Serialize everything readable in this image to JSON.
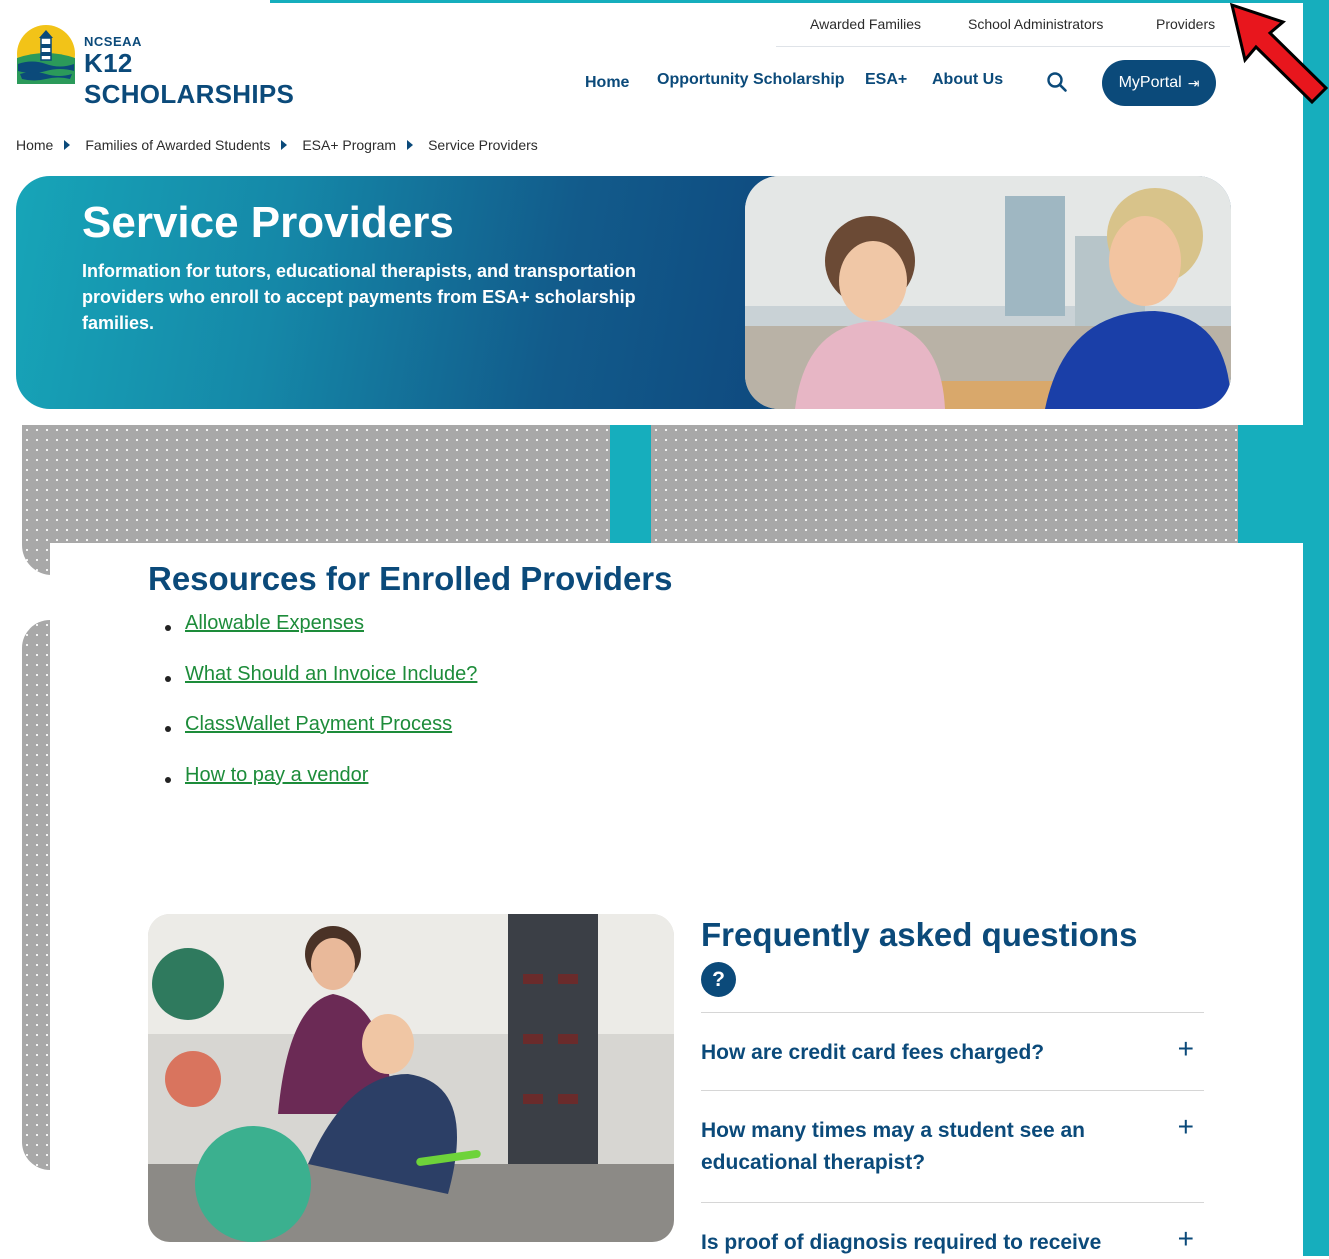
{
  "brand": {
    "small": "NCSEAA",
    "big": "K12 SCHOLARSHIPS"
  },
  "util_nav": [
    "Awarded Families",
    "School Administrators",
    "Providers"
  ],
  "main_nav": [
    "Home",
    "Opportunity Scholarship",
    "ESA+",
    "About Us"
  ],
  "myportal_label": "MyPortal",
  "breadcrumb": [
    "Home",
    "Families of Awarded Students",
    "ESA+ Program",
    "Service Providers"
  ],
  "hero": {
    "title": "Service Providers",
    "subtitle": "Information for tutors, educational therapists, and transportation providers who enroll to accept payments from ESA+ scholarship families."
  },
  "resources": {
    "title": "Resources for Enrolled Providers",
    "links": [
      "Allowable Expenses",
      "What Should an Invoice Include?",
      "ClassWallet Payment Process",
      "How to pay a vendor"
    ]
  },
  "faq": {
    "title": "Frequently asked questions",
    "question_icon": "?",
    "items": [
      "How are credit card fees charged?",
      "How many times may a student see an educational therapist?",
      "Is proof of diagnosis required to receive"
    ]
  },
  "colors": {
    "brand_navy": "#0b4a7a",
    "teal": "#16aebd",
    "link_green": "#1d8c3a",
    "annotation_red": "#e8161d"
  }
}
